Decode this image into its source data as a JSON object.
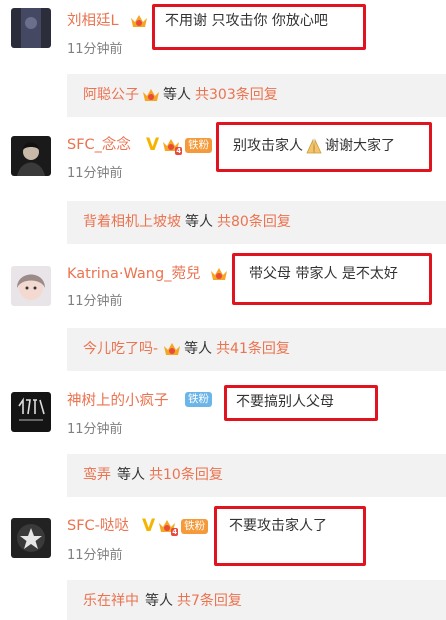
{
  "comments": [
    {
      "username": "刘相廷L",
      "badges": {
        "crown_level": ""
      },
      "text": "不用谢 只攻击你 你放心吧",
      "time": "11分钟前",
      "reply": {
        "name": "阿聪公子",
        "mid": "等人",
        "count": "共303条回复"
      }
    },
    {
      "username": "SFC_念念",
      "badges": {
        "crown_level": "4",
        "fan": "铁粉"
      },
      "text_a": "别攻击家人",
      "text_b": "谢谢大家了",
      "time": "11分钟前",
      "reply": {
        "name": "背着相机上坡坡",
        "mid": "等人",
        "count": "共80条回复"
      }
    },
    {
      "username": "Katrina·Wang_菀兒",
      "badges": {
        "crown_level": ""
      },
      "text": "带父母 带家人 是不太好",
      "time": "11分钟前",
      "reply": {
        "name": "今儿吃了吗-",
        "mid": "等人",
        "count": "共41条回复"
      }
    },
    {
      "username": "神树上的小疯子",
      "badges": {
        "fan": "铁粉"
      },
      "text": "不要搞别人父母",
      "time": "11分钟前",
      "reply": {
        "name": "鸾弄",
        "mid": "等人",
        "count": "共10条回复"
      }
    },
    {
      "username": "SFC-哒哒",
      "badges": {
        "crown_level": "4",
        "fan": "铁粉"
      },
      "text": "不要攻击家人了",
      "time": "11分钟前",
      "reply": {
        "name": "乐在祥中",
        "mid": "等人",
        "count": "共7条回复"
      }
    }
  ],
  "colors": {
    "accent": "#eb7350",
    "highlight_box": "#e0141e",
    "reply_bg": "#f2f2f2"
  },
  "icons": [
    "crown-icon",
    "verified-v-icon",
    "prayer-hands-emoji"
  ]
}
